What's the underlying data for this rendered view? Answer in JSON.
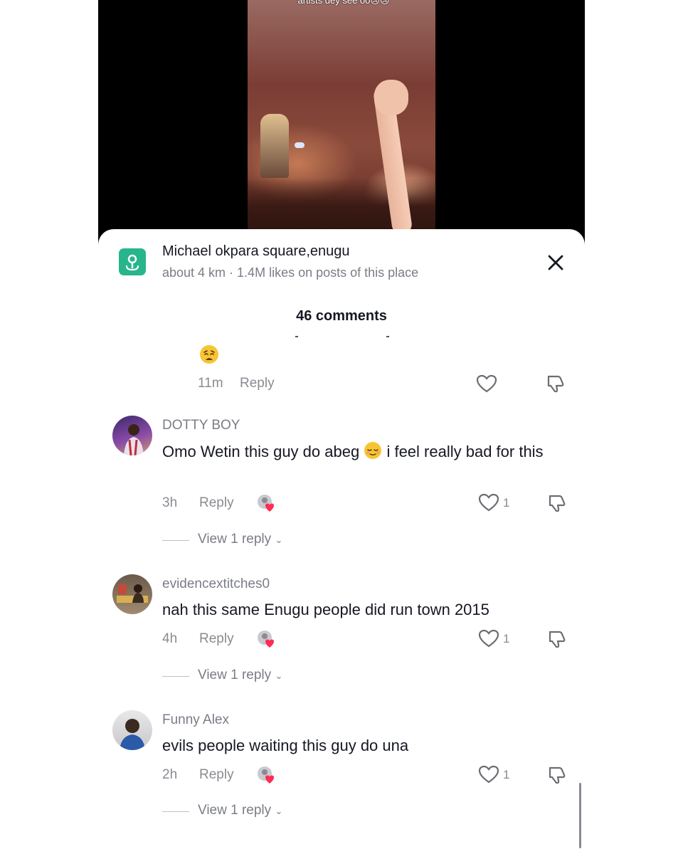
{
  "video": {
    "caption": "artists dey see oo😢😢"
  },
  "location": {
    "title": "Michael okpara square,enugu",
    "subtitle": "about 4 km · 1.4M likes on posts of this place",
    "icon": "location-pin-icon"
  },
  "comments_header": {
    "count_label": "46 comments"
  },
  "top_comment": {
    "emoji": "weary-face",
    "time": "11m",
    "reply_label": "Reply"
  },
  "comments": [
    {
      "username": "DOTTY BOY",
      "text_part1": "Omo Wetin this guy do abeg",
      "emoji": "relieved-face",
      "text_part2": "i feel really bad for this",
      "time": "3h",
      "reply_label": "Reply",
      "likes": "1",
      "view_replies": "View 1 reply"
    },
    {
      "username": "evidencextitches0",
      "text": "nah this same Enugu people did run town 2015",
      "time": "4h",
      "reply_label": "Reply",
      "likes": "1",
      "view_replies": "View 1 reply"
    },
    {
      "username": "Funny Alex",
      "text": "evils people waiting this guy do una",
      "time": "2h",
      "reply_label": "Reply",
      "likes": "1",
      "view_replies": "View 1 reply"
    }
  ],
  "colors": {
    "location_icon": "#28b58c",
    "creator_heart": "#fe2c55",
    "text_primary": "#161823",
    "text_secondary": "#7a7d86"
  }
}
